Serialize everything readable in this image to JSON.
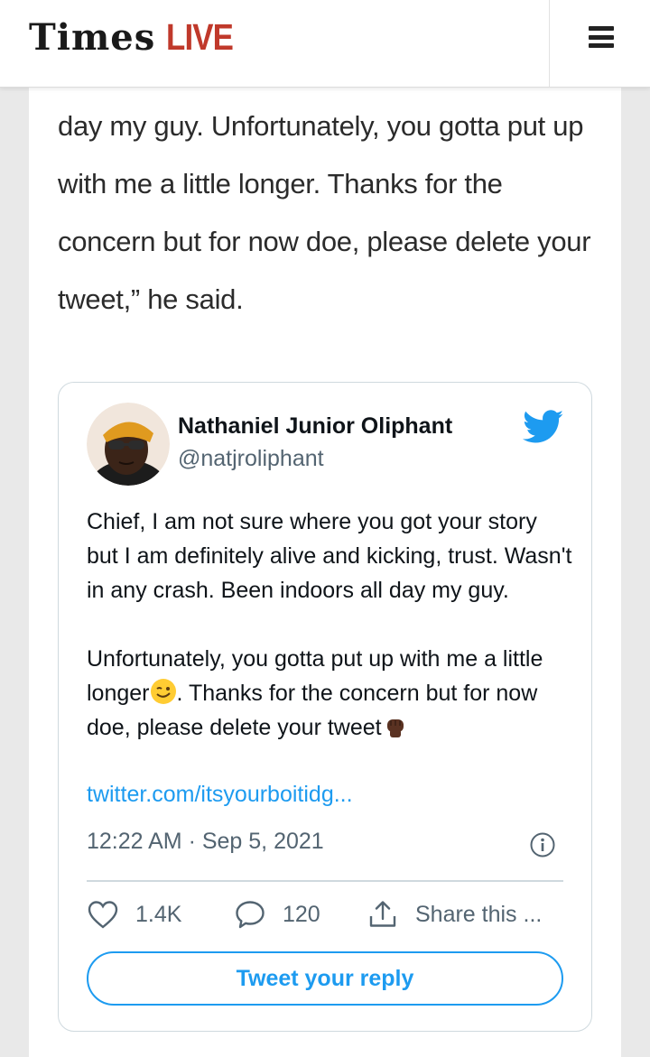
{
  "header": {
    "logo_times": "Times",
    "logo_live": "LIVE"
  },
  "article": {
    "paragraph": "day my guy. Unfortunately, you gotta put up with me a little longer. Thanks for the concern but for now doe, please delete your tweet,” he said."
  },
  "tweet": {
    "author_name": "Nathaniel Junior Oliphant",
    "author_handle": "@natjroliphant",
    "paragraph_1": "Chief, I am not sure where you got your story but I am definitely alive and kicking, trust. Wasn't in any crash. Been indoors all day my guy.",
    "paragraph_2_part_1": "Unfortunately, you gotta put up with me a little longer",
    "paragraph_2_part_2": ". Thanks for the concern but for now doe, please delete your tweet",
    "link": "twitter.com/itsyourboitidg...",
    "timestamp": "12:22 AM · Sep 5, 2021",
    "likes": "1.4K",
    "replies": "120",
    "share_label": "Share this ...",
    "reply_button_label": "Tweet your reply",
    "emojis": [
      "winking-face-emoji",
      "raised-fist-emoji"
    ]
  },
  "colors": {
    "brand_red": "#c0392b",
    "twitter_blue": "#1d9bf0",
    "muted_text": "#536471",
    "border": "#cfd9de"
  },
  "icons": [
    "menu-icon",
    "twitter-bird-icon",
    "info-icon",
    "heart-icon",
    "speech-bubble-icon",
    "share-icon"
  ]
}
